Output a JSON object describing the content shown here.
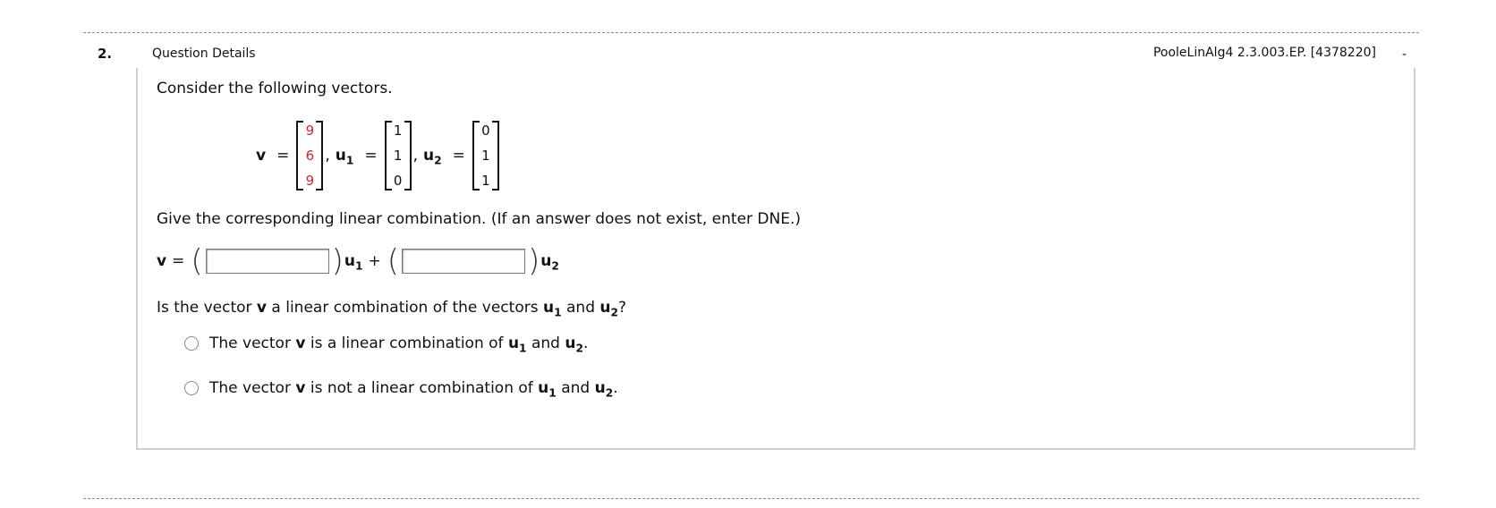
{
  "question": {
    "number": "2.",
    "details_label": "Question Details",
    "id": "PooleLinAlg4 2.3.003.EP. [4378220]",
    "dash": "-",
    "intro": "Consider the following vectors.",
    "vectors": {
      "v_label": "v",
      "v": [
        "9",
        "6",
        "9"
      ],
      "u1_label": "u",
      "u1_sub": "1",
      "u1": [
        "1",
        "1",
        "0"
      ],
      "u2_label": "u",
      "u2_sub": "2",
      "u2": [
        "0",
        "1",
        "1"
      ],
      "equals": "=",
      "comma": ","
    },
    "instruction": "Give the corresponding linear combination. (If an answer does not exist, enter DNE.)",
    "combination": {
      "v_label": "v",
      "equals": "=",
      "plus": "+",
      "open_paren": "(",
      "close_paren": ")",
      "coef1_value": "",
      "coef2_value": ""
    },
    "prompt_parts": {
      "pre": "Is the vector ",
      "v": "v",
      "mid": " a linear combination of the vectors ",
      "u": "u",
      "sub1": "1",
      "and": " and ",
      "sub2": "2",
      "end": "?"
    },
    "options": [
      {
        "pre": "The vector ",
        "v": "v",
        "mid": " is a linear combination of ",
        "u": "u",
        "sub1": "1",
        "and": " and ",
        "sub2": "2",
        "end": "."
      },
      {
        "pre": "The vector ",
        "v": "v",
        "mid": " is not a linear combination of ",
        "u": "u",
        "sub1": "1",
        "and": " and ",
        "sub2": "2",
        "end": "."
      }
    ]
  },
  "colors": {
    "highlight_values": "#d3262b",
    "border": "#cfcfcf",
    "rule": "#8a8a8a"
  }
}
